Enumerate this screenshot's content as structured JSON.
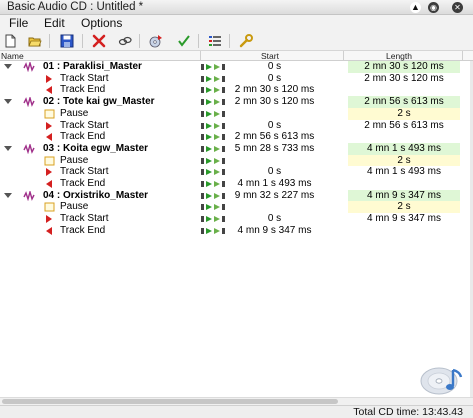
{
  "window": {
    "title": "Basic Audio CD : Untitled *"
  },
  "menu": [
    "File",
    "Edit",
    "Options"
  ],
  "toolbar": [
    {
      "name": "new-icon",
      "label": "New"
    },
    {
      "name": "open-icon",
      "label": "Open"
    },
    {
      "name": "save-icon",
      "label": "Save"
    },
    {
      "name": "delete-icon",
      "label": "Delete"
    },
    {
      "name": "link-icon",
      "label": "Link"
    },
    {
      "name": "burn-icon",
      "label": "Burn"
    },
    {
      "name": "check-icon",
      "label": "Check"
    },
    {
      "name": "properties-icon",
      "label": "Properties"
    },
    {
      "name": "settings-icon",
      "label": "Settings"
    }
  ],
  "columns": {
    "name": "Name",
    "start": "Start",
    "length": "Length"
  },
  "rows": [
    {
      "type": "track",
      "name": "01 : Paraklisi_Master",
      "start": "0 s",
      "length": "2 mn 30 s 120 ms"
    },
    {
      "type": "marker-start",
      "name": "Track Start",
      "start": "0 s",
      "length": "2 mn 30 s 120 ms"
    },
    {
      "type": "marker-end",
      "name": "Track End",
      "start": "2 mn 30 s 120 ms",
      "length": ""
    },
    {
      "type": "track",
      "name": "02 : Tote kai gw_Master",
      "start": "2 mn 30 s 120 ms",
      "length": "2 mn 56 s 613 ms"
    },
    {
      "type": "pause",
      "name": "Pause",
      "start": "",
      "length": "2 s"
    },
    {
      "type": "marker-start",
      "name": "Track Start",
      "start": "0 s",
      "length": "2 mn 56 s 613 ms"
    },
    {
      "type": "marker-end",
      "name": "Track End",
      "start": "2 mn 56 s 613 ms",
      "length": ""
    },
    {
      "type": "track",
      "name": "03 : Koita egw_Master",
      "start": "5 mn 28 s 733 ms",
      "length": "4 mn 1 s 493 ms"
    },
    {
      "type": "pause",
      "name": "Pause",
      "start": "",
      "length": "2 s"
    },
    {
      "type": "marker-start",
      "name": "Track Start",
      "start": "0 s",
      "length": "4 mn 1 s 493 ms"
    },
    {
      "type": "marker-end",
      "name": "Track End",
      "start": "4 mn 1 s 493 ms",
      "length": ""
    },
    {
      "type": "track",
      "name": "04 : Orxistriko_Master",
      "start": "9 mn 32 s 227 ms",
      "length": "4 mn 9 s 347 ms"
    },
    {
      "type": "pause",
      "name": "Pause",
      "start": "",
      "length": "2 s"
    },
    {
      "type": "marker-start",
      "name": "Track Start",
      "start": "0 s",
      "length": "4 mn 9 s 347 ms"
    },
    {
      "type": "marker-end",
      "name": "Track End",
      "start": "4 mn 9 s 347 ms",
      "length": ""
    }
  ],
  "status": {
    "total": "Total CD time: 13:43.43"
  },
  "colors": {
    "length_highlight": "#dff7d6",
    "pause_highlight": "#fffbd2",
    "marker_red": "#d42020",
    "waveform_purple": "#a0308a"
  }
}
